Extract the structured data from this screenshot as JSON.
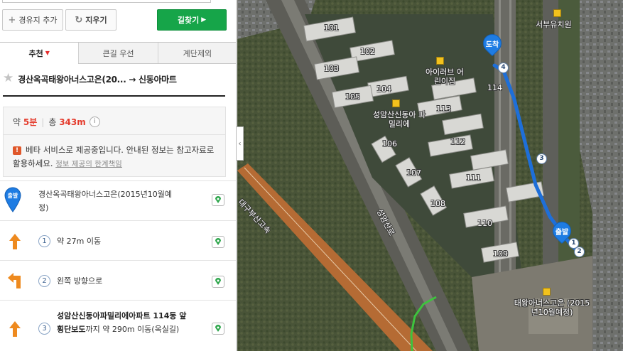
{
  "toolbar": {
    "add_waypoint_label": "경유지 추가",
    "clear_label": "지우기",
    "search_label": "길찾기"
  },
  "tabs": [
    {
      "label": "추천",
      "active": true
    },
    {
      "label": "큰길 우선",
      "active": false
    },
    {
      "label": "계단제외",
      "active": false
    }
  ],
  "route": {
    "title": "경산옥곡태왕아너스고은(20... → 신동아마트",
    "summary_prefix": "약",
    "duration": "5분",
    "total_prefix": "총",
    "distance": "343m",
    "beta_notice": "베타 서비스로 제공중입니다. 안내된 정보는 참고자료로 활용하세요.",
    "beta_link": "정보 제공의 한계책임"
  },
  "steps": [
    {
      "type": "start",
      "pin_label": "출발",
      "text": "경산옥곡태왕아너스고은(2015년10월예정)"
    },
    {
      "type": "straight",
      "num": "1",
      "text": "약 27m 이동"
    },
    {
      "type": "left",
      "num": "2",
      "text": "왼쪽 방향으로"
    },
    {
      "type": "straight",
      "num": "3",
      "bold_text": "성암산신동아파밀리에아파트 114동 앞 횡단보도",
      "text": "까지 약 290m 이동(옥실길)"
    }
  ],
  "map": {
    "end_pin": "도착",
    "start_pin": "출발",
    "labels": {
      "kindergarten_seobu": "서부유치원",
      "iherb": "아이러브 어린이집",
      "apartment_complex": "성암산신동아 파밀리에",
      "taewang": "태왕아너스고은 (2015년10월예정)",
      "expressway": "대구부산고속",
      "road_seongam": "성암산로"
    },
    "buildings": [
      "101",
      "102",
      "103",
      "104",
      "105",
      "106",
      "107",
      "108",
      "109",
      "110",
      "111",
      "112",
      "113",
      "114"
    ],
    "waypoints": [
      "1",
      "2",
      "3",
      "4"
    ]
  },
  "colors": {
    "route_line": "#1e6fd9",
    "go_button": "#16a549",
    "accent_red": "#e43b2c"
  }
}
